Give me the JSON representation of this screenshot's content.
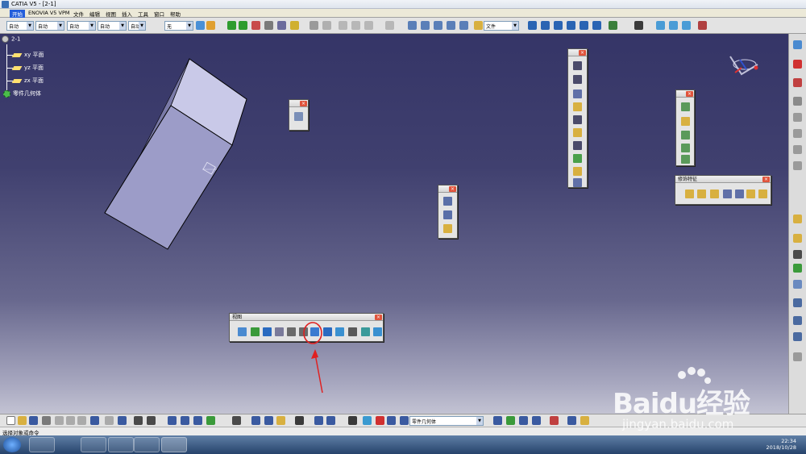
{
  "window": {
    "title": "CATIA V5 - [2-1]"
  },
  "menu": {
    "items": [
      "开始",
      "ENOVIA V5 VPM",
      "文件",
      "编辑",
      "视图",
      "插入",
      "工具",
      "窗口",
      "帮助"
    ]
  },
  "toolbar": {
    "combo1": "自动",
    "combo2": "自动",
    "combo3": "自动",
    "combo4": "自动",
    "combo5": "自动",
    "combo6": "无",
    "combo7": "文件"
  },
  "tree": {
    "root": "2-1",
    "items": [
      "xy 平面",
      "yz 平面",
      "zx 平面",
      "零件几何体"
    ]
  },
  "palettes": {
    "view_title": "视图",
    "feature_title": "修饰特征"
  },
  "bottom": {
    "body_combo": "零件几何体"
  },
  "status": {
    "text": "选择对象或命令"
  },
  "taskbar": {
    "time": "22:34",
    "date": "2018/10/28"
  },
  "watermark": {
    "text": "Baidu经验",
    "url": "jingyan.baidu.com"
  },
  "colors": {
    "accent_highlight": "#e02020",
    "palette_close": "#e0533b"
  }
}
